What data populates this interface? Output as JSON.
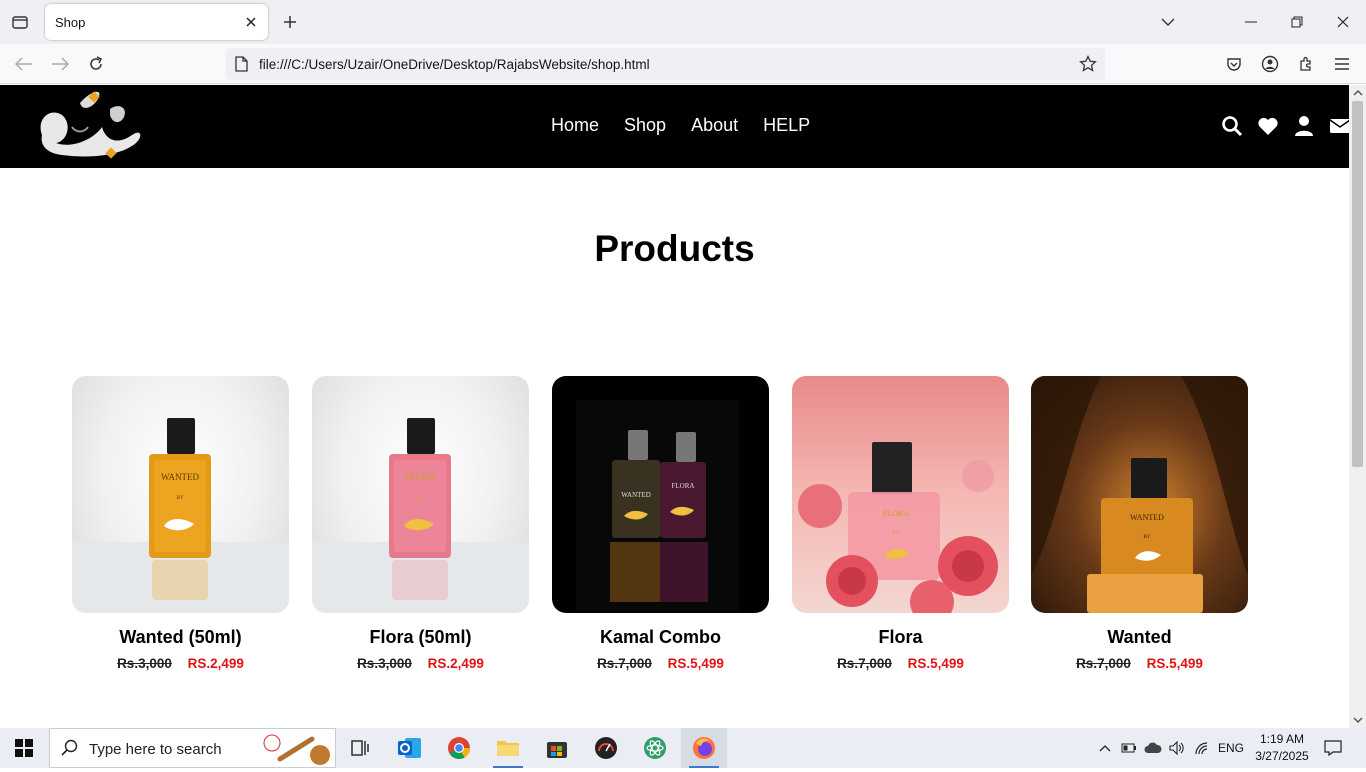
{
  "browser": {
    "tab_title": "Shop",
    "url": "file:///C:/Users/Uzair/OneDrive/Desktop/RajabsWebsite/shop.html"
  },
  "site": {
    "logo_alt": "رجب",
    "nav": [
      "Home",
      "Shop",
      "About",
      "HELP"
    ],
    "header_icons": [
      "search-icon",
      "heart-icon",
      "user-icon",
      "envelope-icon"
    ]
  },
  "page": {
    "title": "Products",
    "products": [
      {
        "name": "Wanted (50ml)",
        "old_price": "Rs.3,000",
        "new_price": "RS.2,499",
        "theme": "amber-light"
      },
      {
        "name": "Flora (50ml)",
        "old_price": "Rs.3,000",
        "new_price": "RS.2,499",
        "theme": "pink-light"
      },
      {
        "name": "Kamal Combo",
        "old_price": "Rs.7,000",
        "new_price": "RS.5,499",
        "theme": "combo-dark"
      },
      {
        "name": "Flora",
        "old_price": "Rs.7,000",
        "new_price": "RS.5,499",
        "theme": "rose"
      },
      {
        "name": "Wanted",
        "old_price": "Rs.7,000",
        "new_price": "RS.5,499",
        "theme": "amber-cave"
      }
    ]
  },
  "taskbar": {
    "search_placeholder": "Type here to search",
    "language": "ENG",
    "time": "1:19 AM",
    "date": "3/27/2025"
  },
  "colors": {
    "header_bg": "#000000",
    "sale_price": "#e31212",
    "taskbar_bg": "#eaeef4"
  }
}
